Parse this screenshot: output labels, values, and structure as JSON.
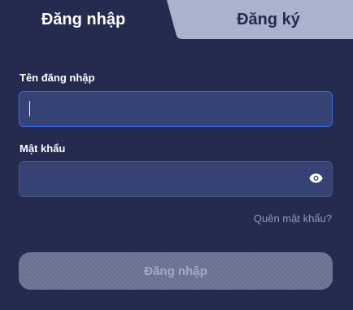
{
  "tabs": {
    "login_label": "Đăng nhập",
    "register_label": "Đăng ký",
    "active": "login"
  },
  "form": {
    "username_label": "Tên đăng nhập",
    "username_value": "",
    "password_label": "Mật khẩu",
    "password_value": "",
    "password_toggle_icon": "eye-icon",
    "forgot_label": "Quên mật khẩu?",
    "submit_label": "Đăng nhập"
  },
  "colors": {
    "background": "#252b4f",
    "inactive_tab": "#aab2ce",
    "input_bg": "#374274",
    "focus_border": "#3568e8",
    "submit_disabled": "#6b7396"
  }
}
